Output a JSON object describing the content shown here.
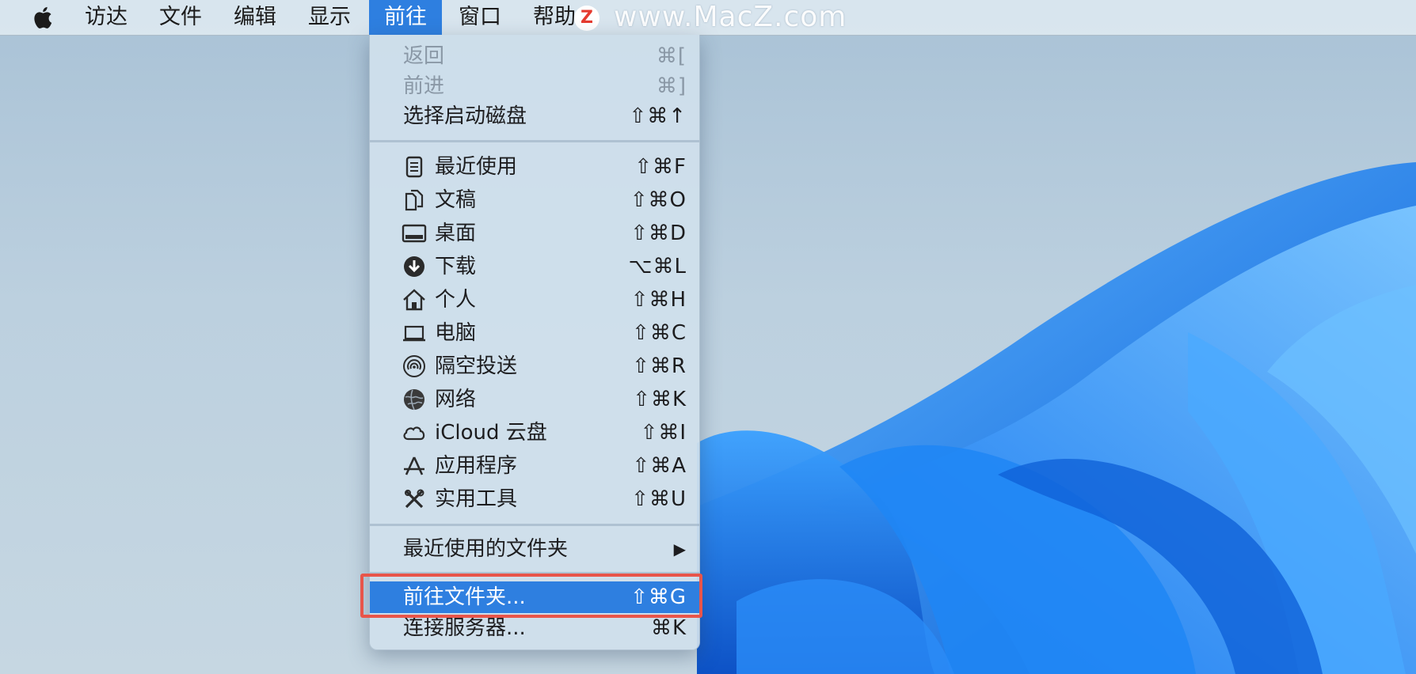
{
  "menubar": {
    "apple": "apple-icon",
    "items": [
      {
        "label": "访达",
        "active": false
      },
      {
        "label": "文件",
        "active": false
      },
      {
        "label": "编辑",
        "active": false
      },
      {
        "label": "显示",
        "active": false
      },
      {
        "label": "前往",
        "active": true
      },
      {
        "label": "窗口",
        "active": false
      },
      {
        "label": "帮助",
        "active": false
      }
    ]
  },
  "watermark": {
    "logo": "Z",
    "text": "www.MacZ.com"
  },
  "go_menu": {
    "items": [
      {
        "label": "返回",
        "shortcut": "⌘[",
        "enabled": false
      },
      {
        "label": "前进",
        "shortcut": "⌘]",
        "enabled": false
      },
      {
        "label": "选择启动磁盘",
        "shortcut": "⇧⌘↑",
        "enabled": true
      },
      {
        "label": "最近使用",
        "shortcut": "⇧⌘F",
        "icon": "recents-icon"
      },
      {
        "label": "文稿",
        "shortcut": "⇧⌘O",
        "icon": "documents-icon"
      },
      {
        "label": "桌面",
        "shortcut": "⇧⌘D",
        "icon": "desktop-icon"
      },
      {
        "label": "下载",
        "shortcut": "⌥⌘L",
        "icon": "downloads-icon"
      },
      {
        "label": "个人",
        "shortcut": "⇧⌘H",
        "icon": "home-icon"
      },
      {
        "label": "电脑",
        "shortcut": "⇧⌘C",
        "icon": "computer-icon"
      },
      {
        "label": "隔空投送",
        "shortcut": "⇧⌘R",
        "icon": "airdrop-icon"
      },
      {
        "label": "网络",
        "shortcut": "⇧⌘K",
        "icon": "network-icon"
      },
      {
        "label": "iCloud 云盘",
        "shortcut": "⇧⌘I",
        "icon": "icloud-icon"
      },
      {
        "label": "应用程序",
        "shortcut": "⇧⌘A",
        "icon": "applications-icon"
      },
      {
        "label": "实用工具",
        "shortcut": "⇧⌘U",
        "icon": "utilities-icon"
      },
      {
        "label": "最近使用的文件夹",
        "shortcut": "▶",
        "submenu": true
      },
      {
        "label": "前往文件夹...",
        "shortcut": "⇧⌘G",
        "highlighted": true
      },
      {
        "label": "连接服务器...",
        "shortcut": "⌘K"
      }
    ]
  },
  "colors": {
    "highlight": "#2e7fe0",
    "annotation_box": "#e8554a"
  }
}
